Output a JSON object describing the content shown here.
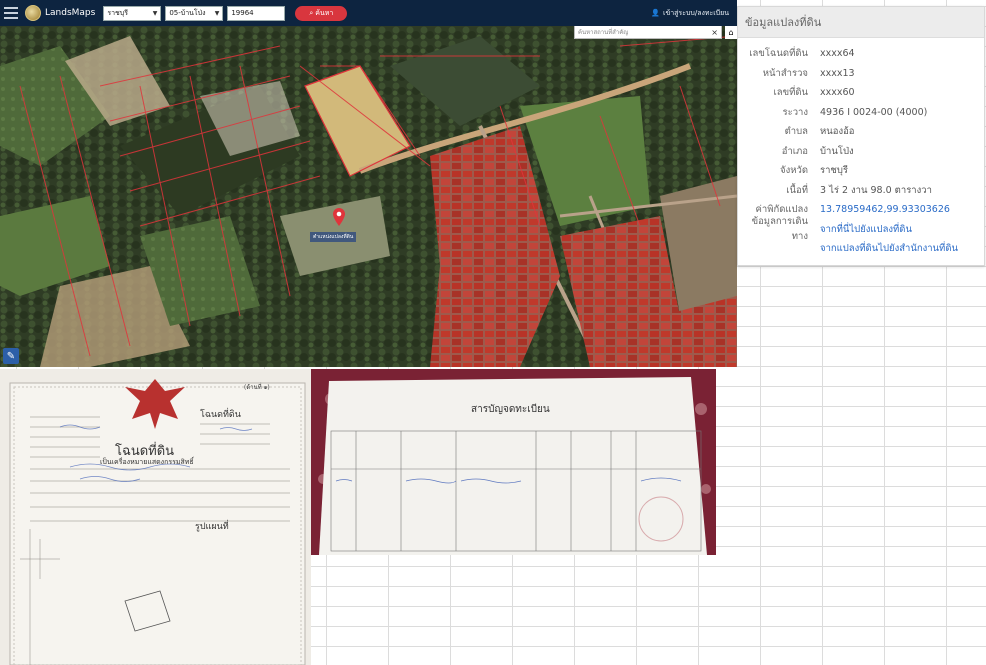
{
  "app": {
    "name": "LandsMaps"
  },
  "search_bar": {
    "province": "ราชบุรี",
    "district": "05-บ้านโป่ง",
    "parcel_number": "19964",
    "search_label": "ค้นหา",
    "login_label": "เข้าสู่ระบบ/ลงทะเบียน"
  },
  "map": {
    "place_search_placeholder": "ค้นหาสถานที่สำคัญ",
    "close_symbol": "×",
    "pin_label": "ตำแหน่งแปลงที่ดิน"
  },
  "info_panel": {
    "title": "ข้อมูลแปลงที่ดิน",
    "rows": [
      {
        "label": "เลขโฉนดที่ดิน",
        "value": "xxxx64"
      },
      {
        "label": "หน้าสำรวจ",
        "value": "xxxx13"
      },
      {
        "label": "เลขที่ดิน",
        "value": "xxxx60"
      },
      {
        "label": "ระวาง",
        "value": "4936 I 0024-00 (4000)"
      },
      {
        "label": "ตำบล",
        "value": "หนองอ้อ"
      },
      {
        "label": "อำเภอ",
        "value": "บ้านโป่ง"
      },
      {
        "label": "จังหวัด",
        "value": "ราชบุรี"
      },
      {
        "label": "เนื้อที่",
        "value": "3 ไร่ 2 งาน 98.0 ตารางวา"
      },
      {
        "label": "ค่าพิกัดแปลง",
        "value": "13.78959462,99.93303626"
      },
      {
        "label": "ข้อมูลการเดินทาง",
        "value": "จากที่นี่ไปยังแปลงที่ดิน"
      }
    ],
    "extra_link": "จากแปลงที่ดินไปยังสำนักงานที่ดิน"
  },
  "documents": {
    "deed_title": "โฉนดที่ดิน",
    "deed_header_right": "โฉนดที่ดิน",
    "deed_subtitle": "เป็นเครื่องหมายแสดงกรรมสิทธิ์",
    "deed_page": "(ด้านที่ ๑)",
    "deed_footer_label": "รูปแผนที่",
    "registry_title": "สารบัญจดทะเบียน"
  },
  "colors": {
    "topbar": "#0d2440",
    "search_button": "#d9363e",
    "link": "#2a6bc7",
    "parcel_line": "#e0343b"
  }
}
